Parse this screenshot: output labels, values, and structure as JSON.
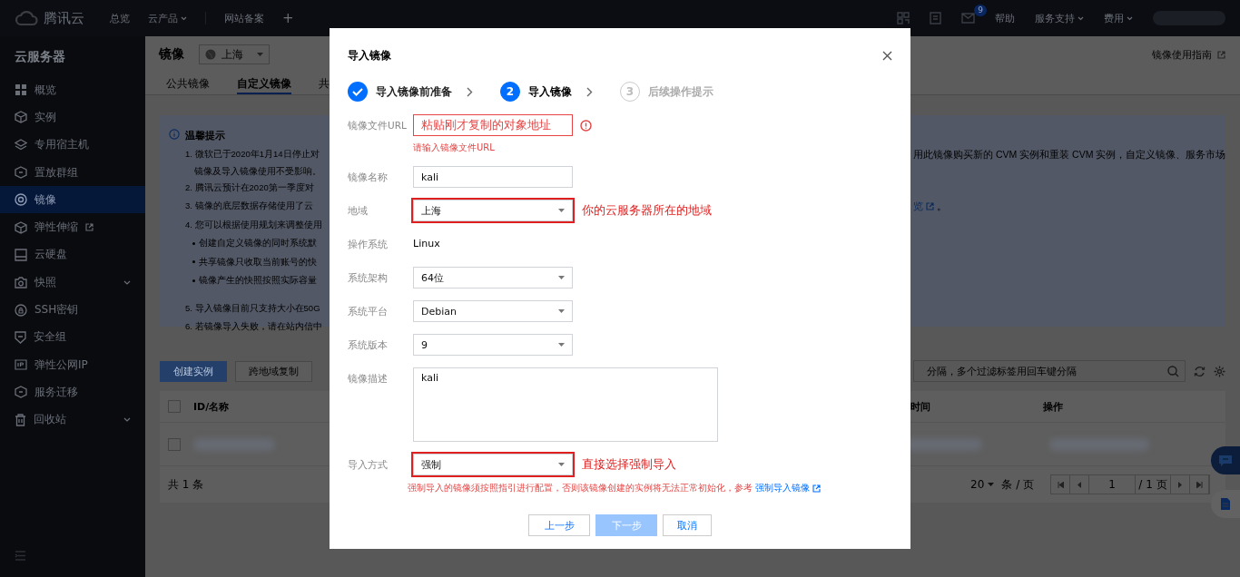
{
  "topbar": {
    "logo": "腾讯云",
    "nav": [
      {
        "label": "总览",
        "dropdown": false
      },
      {
        "label": "云产品",
        "dropdown": true
      },
      {
        "label": "网站备案",
        "dropdown": false
      }
    ],
    "add": "+",
    "mail_badge": "9",
    "links": [
      {
        "label": "帮助",
        "dropdown": false
      },
      {
        "label": "服务支持",
        "dropdown": true
      },
      {
        "label": "费用",
        "dropdown": true
      }
    ]
  },
  "sidebar": {
    "title": "云服务器",
    "items": [
      {
        "label": "概览",
        "selected": false,
        "external": false,
        "expandable": false
      },
      {
        "label": "实例",
        "selected": false,
        "external": false,
        "expandable": false
      },
      {
        "label": "专用宿主机",
        "selected": false,
        "external": false,
        "expandable": false
      },
      {
        "label": "置放群组",
        "selected": false,
        "external": false,
        "expandable": false
      },
      {
        "label": "镜像",
        "selected": true,
        "external": false,
        "expandable": false
      },
      {
        "label": "弹性伸缩",
        "selected": false,
        "external": true,
        "expandable": false
      },
      {
        "label": "云硬盘",
        "selected": false,
        "external": false,
        "expandable": false
      },
      {
        "label": "快照",
        "selected": false,
        "external": false,
        "expandable": true
      },
      {
        "label": "SSH密钥",
        "selected": false,
        "external": false,
        "expandable": false
      },
      {
        "label": "安全组",
        "selected": false,
        "external": false,
        "expandable": false
      },
      {
        "label": "弹性公网IP",
        "selected": false,
        "external": false,
        "expandable": false
      },
      {
        "label": "服务迁移",
        "selected": false,
        "external": false,
        "expandable": false
      },
      {
        "label": "回收站",
        "selected": false,
        "external": false,
        "expandable": true
      }
    ]
  },
  "page": {
    "title": "镜像",
    "region": "上海",
    "guide_link": "镜像使用指南",
    "tabs": [
      {
        "label": "公共镜像",
        "selected": false
      },
      {
        "label": "自定义镜像",
        "selected": true
      },
      {
        "label": "共",
        "selected": false
      }
    ]
  },
  "notice": {
    "title": "温馨提示",
    "lines": [
      {
        "kind": "item",
        "left": "1. 微软已于2020年1月14日停止对",
        "right": "用此镜像购买新的 CVM 实例和重装 CVM 实例，自定义镜像、服务市场"
      },
      {
        "kind": "cont",
        "left": "镜像及导入镜像使用不受影响。"
      },
      {
        "kind": "item",
        "left": "2. 腾讯云预计在2020第一季度对"
      },
      {
        "kind": "item",
        "left": "3. 镜像的底层数据存储使用了云",
        "right_link": "览",
        "right_tail": "。"
      },
      {
        "kind": "item",
        "left": "4. 您可以根据使用规划来调整使用"
      },
      {
        "kind": "bullet",
        "left": "创建自定义镜像的同时系统默"
      },
      {
        "kind": "bullet",
        "left": "共享镜像只收取当前账号的快"
      },
      {
        "kind": "bullet",
        "left": "镜像产生的快照按照实际容量"
      },
      {
        "kind": "item",
        "left": "5. 导入镜像目前只支持大小在50G"
      },
      {
        "kind": "item",
        "left": "6. 若镜像导入失败，请在站内信中"
      }
    ]
  },
  "toolbar": {
    "buttons": [
      {
        "label": "创建实例",
        "primary": true
      },
      {
        "label": "跨地域复制",
        "primary": false
      }
    ],
    "search_placeholder": "分隔，多个过滤标签用回车键分隔"
  },
  "table": {
    "header_checkbox": {
      "checked": false
    },
    "rows": [
      {
        "checked": false
      }
    ],
    "left_columns": [
      "ID/名称"
    ],
    "right_columns": [
      "时间",
      "操作"
    ],
    "total": "共 1 条",
    "page_size": "20",
    "per_page": "条 / 页",
    "page": "1",
    "pages": "/ 1 页"
  },
  "dialog": {
    "title": "导入镜像",
    "steps": [
      {
        "label": "导入镜像前准备",
        "completed": true,
        "selected": false
      },
      {
        "number": "2",
        "label": "导入镜像",
        "completed": false,
        "selected": true
      },
      {
        "number": "3",
        "label": "后续操作提示",
        "completed": false,
        "selected": false
      }
    ],
    "fields": [
      {
        "kind": "text",
        "label": "镜像文件URL",
        "annotation": "粘贴刚才复制的对象地址",
        "error": "请输入镜像文件URL",
        "highlighted": false
      },
      {
        "kind": "text",
        "label": "镜像名称",
        "value": "kali",
        "highlighted": false
      },
      {
        "kind": "select",
        "label": "地域",
        "value": "上海",
        "highlighted": true,
        "annotation": "你的云服务器所在的地域"
      },
      {
        "kind": "static",
        "label": "操作系统",
        "value": "Linux"
      },
      {
        "kind": "select",
        "label": "系统架构",
        "value": "64位",
        "highlighted": false
      },
      {
        "kind": "select",
        "label": "系统平台",
        "value": "Debian",
        "highlighted": false
      },
      {
        "kind": "select",
        "label": "系统版本",
        "value": "9",
        "highlighted": false
      },
      {
        "kind": "textarea",
        "label": "镜像描述",
        "value": "kali"
      },
      {
        "kind": "select",
        "label": "导入方式",
        "value": "强制",
        "highlighted": true,
        "annotation": "直接选择强制导入",
        "note": "强制导入的镜像须按照指引进行配置，否则该镜像创建的实例将无法正常初始化，参考",
        "note_link": "强制导入镜像"
      }
    ],
    "buttons": [
      {
        "label": "上一步",
        "primary": false,
        "disabled": false
      },
      {
        "label": "下一步",
        "primary": true,
        "disabled": true
      },
      {
        "label": "取消",
        "primary": false,
        "disabled": false
      }
    ]
  }
}
